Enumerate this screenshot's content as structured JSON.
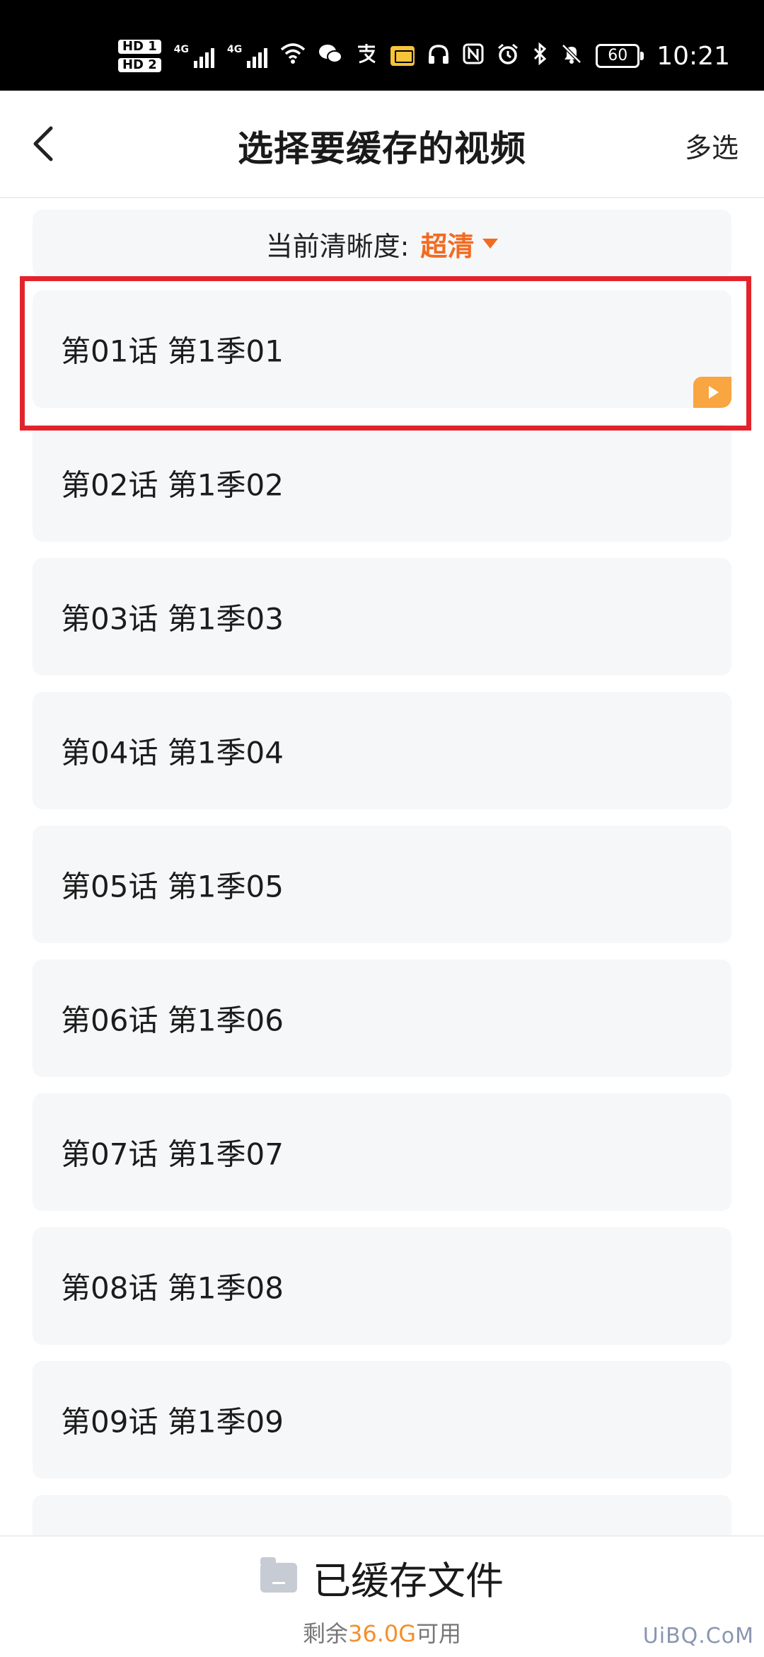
{
  "status_bar": {
    "hd1": "HD 1",
    "hd2": "HD 2",
    "network": "4G",
    "battery": "60",
    "time": "10:21"
  },
  "header": {
    "title": "选择要缓存的视频",
    "multi_select": "多选"
  },
  "quality": {
    "label": "当前清晰度:",
    "value": "超清"
  },
  "episodes": [
    {
      "label": "第01话 第1季01",
      "selected": true
    },
    {
      "label": "第02话 第1季02"
    },
    {
      "label": "第03话 第1季03"
    },
    {
      "label": "第04话 第1季04"
    },
    {
      "label": "第05话 第1季05"
    },
    {
      "label": "第06话 第1季06"
    },
    {
      "label": "第07话 第1季07"
    },
    {
      "label": "第08话 第1季08"
    },
    {
      "label": "第09话 第1季09"
    },
    {
      "label": ""
    }
  ],
  "footer": {
    "cached_files": "已缓存文件",
    "remaining_prefix": "剩余",
    "remaining_amount": "36.0G",
    "remaining_suffix": "可用"
  },
  "watermark": "UiBQ.CoM",
  "colors": {
    "accent": "#f26b21",
    "highlight": "#e3232c",
    "badge": "#f8a542"
  }
}
